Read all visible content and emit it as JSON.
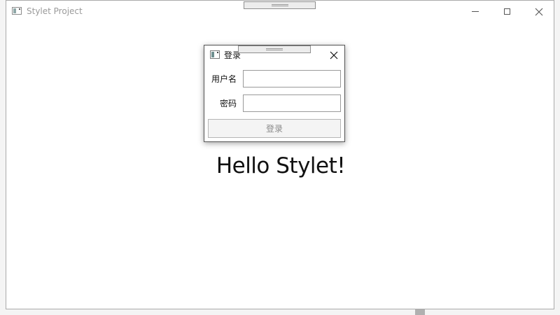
{
  "window": {
    "title": "Stylet Project",
    "content_text": "Hello Stylet!"
  },
  "dialog": {
    "title": "登录",
    "username_label": "用户名",
    "username_value": "",
    "password_label": "密码",
    "password_value": "",
    "login_button_label": "登录"
  }
}
